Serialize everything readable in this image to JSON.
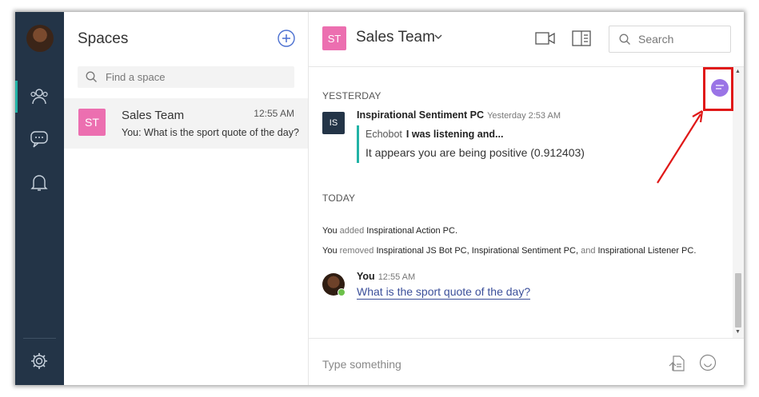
{
  "sidebar": {
    "icons": [
      "avatar",
      "people-icon",
      "chat-bubble-icon",
      "bell-icon",
      "gear-icon"
    ]
  },
  "spaces_panel": {
    "title": "Spaces",
    "search_placeholder": "Find a space",
    "items": [
      {
        "badge": "ST",
        "name": "Sales Team",
        "time": "12:55 AM",
        "preview": "You: What is the sport quote of the day?"
      }
    ]
  },
  "header": {
    "badge": "ST",
    "title": "Sales Team",
    "search_placeholder": "Search"
  },
  "messages": {
    "day_yesterday": "YESTERDAY",
    "bot_badge": "IS",
    "bot_sender": "Inspirational Sentiment PC",
    "bot_time": "Yesterday 2:53 AM",
    "quote_author": "Echobot",
    "quote_text": "I was listening and...",
    "bot_reply": "It appears you are being positive (0.912403)",
    "day_today": "TODAY",
    "sys1_you": "You",
    "sys1_verb": "added",
    "sys1_target": "Inspirational Action PC.",
    "sys2_you": "You",
    "sys2_verb": "removed",
    "sys2_t1": "Inspirational JS Bot PC,",
    "sys2_t2": "Inspirational Sentiment PC,",
    "sys2_and": "and",
    "sys2_t3": "Inspirational Listener PC.",
    "you_name": "You",
    "you_time": "12:55 AM",
    "you_msg": "What is the sport quote of the day?"
  },
  "composer": {
    "placeholder": "Type something"
  },
  "colors": {
    "rail": "#233447",
    "accent_teal": "#22b3a6",
    "badge_pink": "#ec6fb0",
    "highlight_red": "#e01818",
    "link_blue": "#3b4f9a"
  }
}
